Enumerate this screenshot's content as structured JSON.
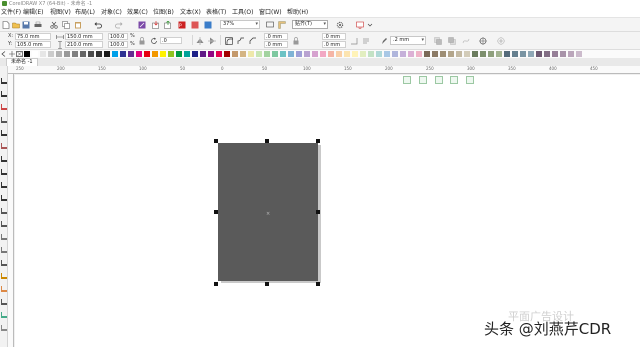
{
  "title_bar": {
    "title": "CorelDRAW X7 (64-Bit) - 未命名 -1"
  },
  "menu": [
    "文件(F)",
    "编辑(E)",
    "视图(V)",
    "布局(L)",
    "对象(C)",
    "效果(C)",
    "位图(B)",
    "文本(X)",
    "表格(T)",
    "工具(O)",
    "窗口(W)",
    "帮助(H)"
  ],
  "standard_toolbar": {
    "zoom": "37%",
    "snap": "贴齐(T)"
  },
  "property_bar": {
    "x_label": "X:",
    "x_value": "75.0 mm",
    "y_label": "Y:",
    "y_value": "105.0 mm",
    "w_value": "150.0 mm",
    "h_value": "210.0 mm",
    "scale_x": "100.0",
    "scale_y": "100.0",
    "percent": "%",
    "rotation": ".0",
    "corner_1": ".0 mm",
    "corner_2": ".0 mm",
    "corner_3": ".0 mm",
    "corner_4": ".0 mm",
    "outline_width": ".2 mm"
  },
  "palette": [
    "#000000",
    "#ffffff",
    "#e6e6e6",
    "#cccccc",
    "#b3b3b3",
    "#999999",
    "#808080",
    "#666666",
    "#4d4d4d",
    "#333333",
    "#1a1a1a",
    "#00a0e9",
    "#2e3192",
    "#662d91",
    "#e4007f",
    "#e60012",
    "#f39800",
    "#fff100",
    "#8fc31f",
    "#009944",
    "#00a29a",
    "#1d2088",
    "#601986",
    "#920783",
    "#e5004f",
    "#a40000",
    "#c4996c",
    "#d4b483",
    "#eee8aa",
    "#c8e6b4",
    "#a3d3a0",
    "#7ec8a0",
    "#6bc2c4",
    "#7fb3d5",
    "#9fa0d7",
    "#b8a2d1",
    "#d6a2cf",
    "#f2a7c3",
    "#f5b5a6",
    "#f9d0a9",
    "#fce4b0",
    "#fff3b8",
    "#e2eec0",
    "#c3e2c5",
    "#b0d9d8",
    "#a9c8e6",
    "#b0b6dc",
    "#c5b0d9",
    "#dcb0d5",
    "#efb4c8",
    "#7b6a58",
    "#8c7b66",
    "#9e8e75",
    "#b3a58b",
    "#c4baa4",
    "#d3ccb9",
    "#6b7c5e",
    "#7d8f6d",
    "#8fa07d",
    "#a3b391",
    "#556b7b",
    "#66808f",
    "#7a94a3",
    "#8fa8b6",
    "#6f5a72",
    "#826d84",
    "#967f97",
    "#a893a9",
    "#bba6bb",
    "#ccbbcc"
  ],
  "doc_tab": "未命名 -1",
  "ruler_labels": [
    "250",
    "200",
    "150",
    "100",
    "50",
    "0",
    "50",
    "100",
    "150",
    "200",
    "250",
    "300",
    "350",
    "400",
    "450"
  ],
  "watermark": {
    "line1": "平面广告设计",
    "line2": "头条 @刘燕芹CDR"
  }
}
